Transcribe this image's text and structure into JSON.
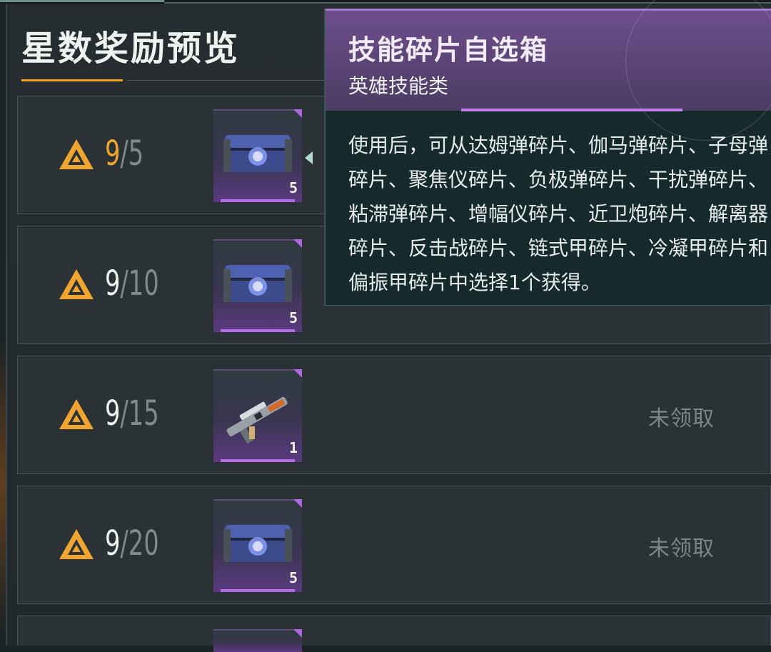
{
  "title": "星数奖励预览",
  "rows": [
    {
      "current": "9",
      "separator": "/",
      "goal": "5",
      "item_count": "5",
      "item_type": "chest",
      "status": ""
    },
    {
      "current": "9",
      "separator": "/",
      "goal": "10",
      "item_count": "5",
      "item_type": "chest",
      "status": ""
    },
    {
      "current": "9",
      "separator": "/",
      "goal": "15",
      "item_count": "1",
      "item_type": "weapon",
      "status": "未领取"
    },
    {
      "current": "9",
      "separator": "/",
      "goal": "20",
      "item_count": "5",
      "item_type": "chest",
      "status": "未领取"
    }
  ],
  "tooltip": {
    "title": "技能碎片自选箱",
    "subtitle": "英雄技能类",
    "description": "使用后，可从达姆弹碎片、伽马弹碎片、子母弹碎片、聚焦仪碎片、负极弹碎片、干扰弹碎片、粘滞弹碎片、增幅仪碎片、近卫炮碎片、解离器碎片、反击战碎片、链式甲碎片、冷凝甲碎片和偏振甲碎片中选择1个获得。"
  },
  "icons": {
    "star_icon": "triangle-star-icon",
    "chest_icon": "chest-icon",
    "weapon_icon": "rifle-icon"
  },
  "colors": {
    "accent_gold": "#f0a21c",
    "item_purple": "#b36be8",
    "tooltip_header": "#6e4f8c"
  }
}
